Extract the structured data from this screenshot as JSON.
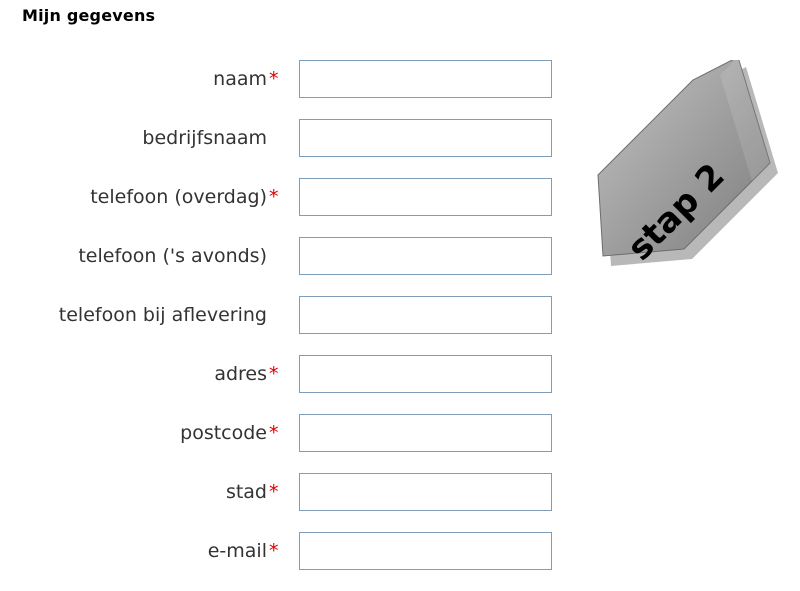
{
  "section": {
    "title": "Mijn gegevens"
  },
  "form": {
    "required_marker": "*",
    "fields": [
      {
        "label": "naam",
        "required": true,
        "value": ""
      },
      {
        "label": "bedrijfsnaam",
        "required": false,
        "value": ""
      },
      {
        "label": "telefoon (overdag)",
        "required": true,
        "value": ""
      },
      {
        "label": "telefoon ('s avonds)",
        "required": false,
        "value": ""
      },
      {
        "label": "telefoon bij aflevering",
        "required": false,
        "value": ""
      },
      {
        "label": "adres",
        "required": true,
        "value": ""
      },
      {
        "label": "postcode",
        "required": true,
        "value": ""
      },
      {
        "label": "stad",
        "required": true,
        "value": ""
      },
      {
        "label": "e-mail",
        "required": true,
        "value": ""
      }
    ]
  },
  "step_badge": {
    "text": "stap 2",
    "icon": "arrow-down-left-icon",
    "arrow_color": "#a0a0a0"
  },
  "colors": {
    "required": "#dd0000",
    "input_border": "#7f9db9"
  }
}
